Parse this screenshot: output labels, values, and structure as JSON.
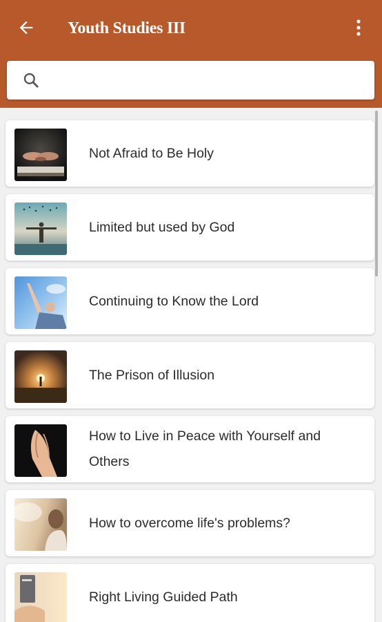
{
  "app": {
    "title": "Youth Studies III",
    "back_icon": "arrow-back-icon",
    "menu_icon": "more-vert-icon",
    "accent_color": "#b8592b"
  },
  "search": {
    "icon": "search-icon",
    "value": "",
    "placeholder": ""
  },
  "studies": [
    {
      "title": "Not Afraid to Be Holy",
      "image": "open-hands-over-bible"
    },
    {
      "title": "Limited but used by God",
      "image": "man-arms-outstretched-birds"
    },
    {
      "title": "Continuing to Know the Lord",
      "image": "person-reaching-to-sky"
    },
    {
      "title": "The Prison of Illusion",
      "image": "figure-at-sunset"
    },
    {
      "title": "How to Live in Peace with Yourself and Others",
      "image": "praying-hands"
    },
    {
      "title": "How to overcome life's problems?",
      "image": "person-in-sunlight"
    },
    {
      "title": "Right Living Guided Path",
      "image": "hands-holding-bible"
    }
  ]
}
